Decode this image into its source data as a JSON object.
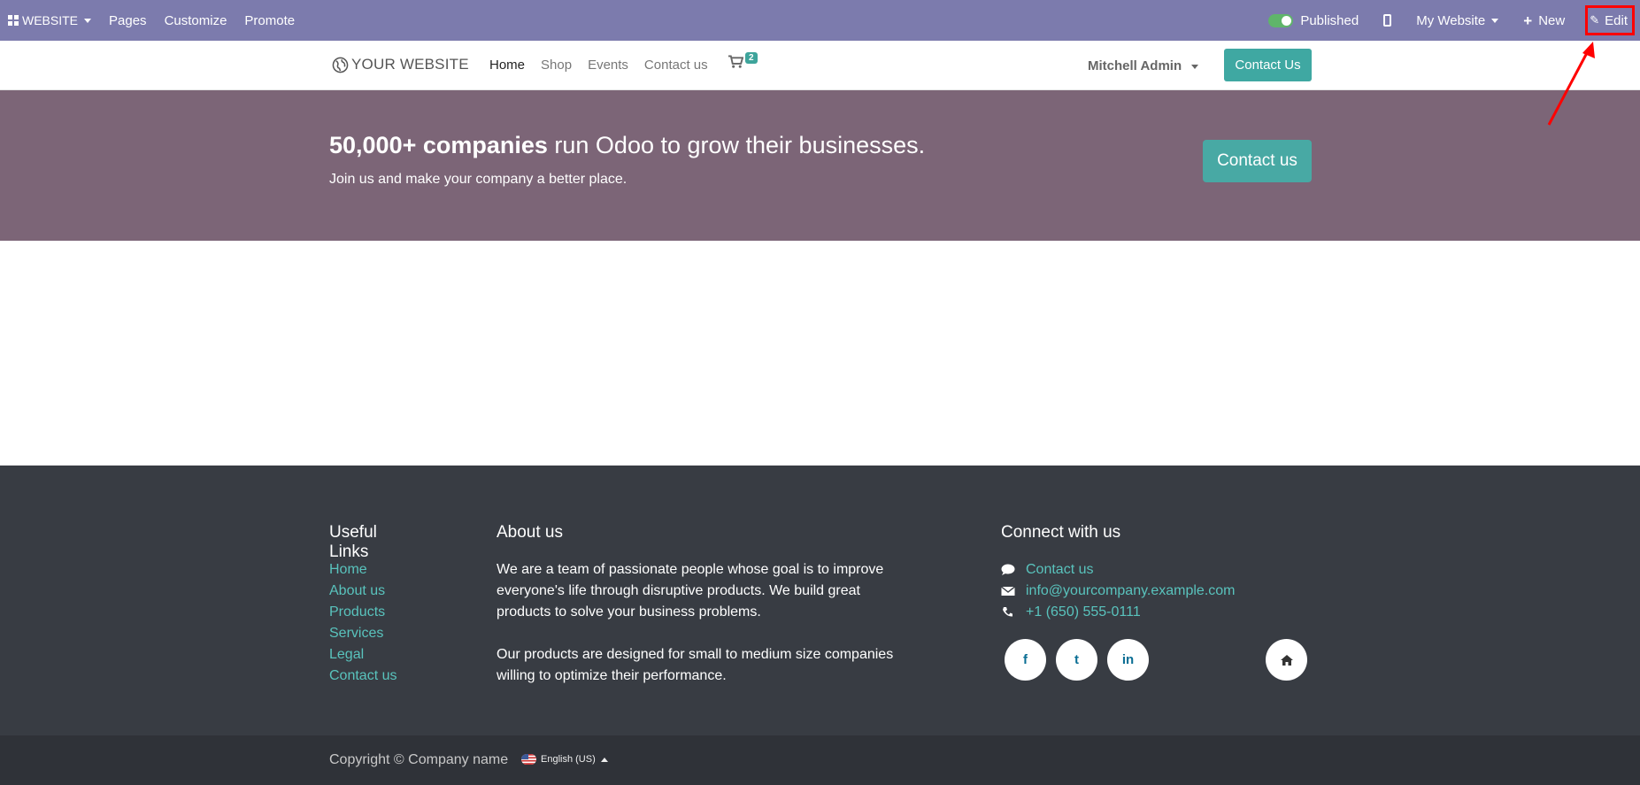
{
  "admin_bar": {
    "app_name": "WEBSITE",
    "menu": [
      "Pages",
      "Customize",
      "Promote"
    ],
    "published_label": "Published",
    "website_selector": "My Website",
    "new_label": "New",
    "edit_label": "Edit",
    "background": "#7c7bad"
  },
  "header": {
    "logo_text": "YOUR WEBSITE",
    "nav": [
      "Home",
      "Shop",
      "Events",
      "Contact us"
    ],
    "cart_count": "2",
    "user_name": "Mitchell Admin",
    "cta_label": "Contact Us"
  },
  "banner": {
    "headline_bold": "50,000+ companies",
    "headline_rest": " run Odoo to grow their businesses.",
    "subtext": "Join us and make your company a better place.",
    "button_label": "Contact us",
    "background": "#7c6577"
  },
  "footer": {
    "useful_links_title": "Useful Links",
    "useful_links": [
      "Home",
      "About us",
      "Products",
      "Services",
      "Legal",
      "Contact us"
    ],
    "about_title": "About us",
    "about_p1": "We are a team of passionate people whose goal is to improve everyone's life through disruptive products. We build great products to solve your business problems.",
    "about_p2": "Our products are designed for small to medium size companies willing to optimize their performance.",
    "connect_title": "Connect with us",
    "contact_label": "Contact us",
    "email": "info@yourcompany.example.com",
    "phone": "+1 (650) 555-0111",
    "social": {
      "facebook": "f",
      "twitter": "t",
      "linkedin": "in"
    },
    "copyright": "Copyright © Company name",
    "language": "English (US)"
  },
  "colors": {
    "accent": "#3fa8a2",
    "footer_bg": "#383c43",
    "link": "#59c3bd",
    "highlight": "#ff0000"
  }
}
